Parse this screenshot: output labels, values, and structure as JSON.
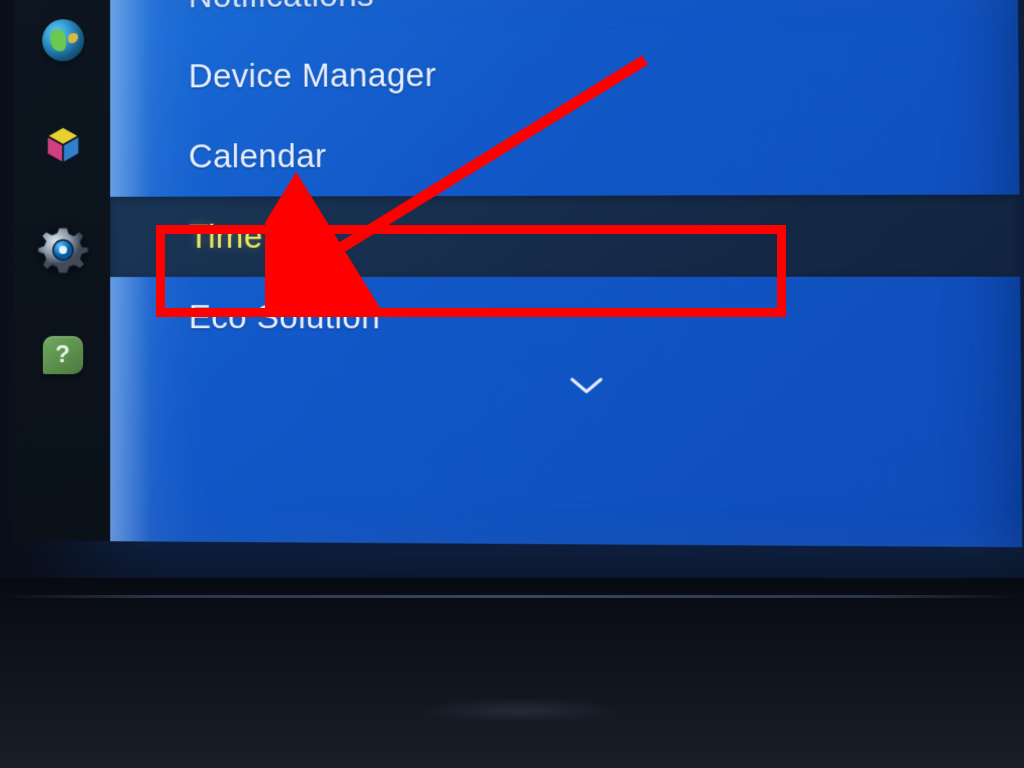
{
  "sidebar": {
    "icons": [
      {
        "name": "globe-icon"
      },
      {
        "name": "smart-hub-icon"
      },
      {
        "name": "settings-gear-icon"
      },
      {
        "name": "help-icon",
        "symbol": "?"
      }
    ]
  },
  "menu": {
    "items": [
      {
        "label": "Notifications",
        "partial": true,
        "selected": false
      },
      {
        "label": "Device Manager",
        "partial": false,
        "selected": false
      },
      {
        "label": "Calendar",
        "partial": false,
        "selected": false
      },
      {
        "label": "Time",
        "partial": false,
        "selected": true
      },
      {
        "label": "Eco Solution",
        "partial": false,
        "selected": false
      }
    ],
    "more_below": true
  },
  "annotation": {
    "target_index": 3,
    "highlight_color": "#ff0000"
  }
}
